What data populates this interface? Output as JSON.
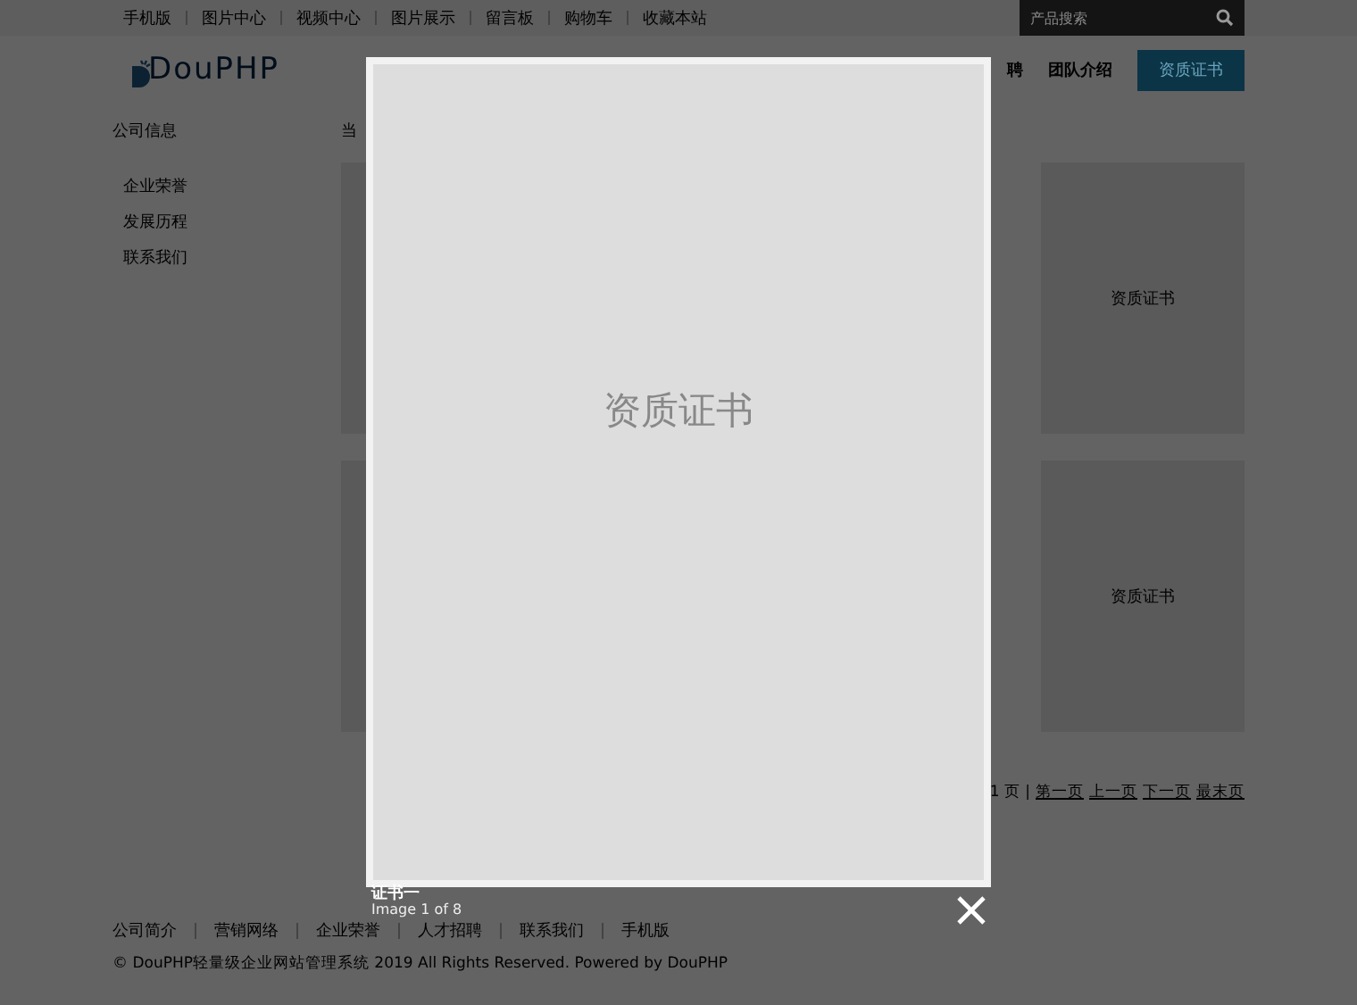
{
  "top_bar": {
    "links": [
      "手机版",
      "图片中心",
      "视频中心",
      "图片展示",
      "留言板",
      "购物车",
      "收藏本站"
    ],
    "search": {
      "placeholder": "产品搜索"
    }
  },
  "header": {
    "logo": "DouPHP",
    "nav": [
      {
        "label": "聘",
        "selected": false
      },
      {
        "label": "团队介绍",
        "selected": false
      },
      {
        "label": "资质证书",
        "selected": true
      }
    ]
  },
  "sidebar": {
    "title": "公司信息",
    "items": [
      "企业荣誉",
      "发展历程",
      "联系我们"
    ]
  },
  "breadcrumb": "当",
  "cards": [
    {
      "kind": "covered"
    },
    {
      "kind": "thumb",
      "label": "资质证书"
    },
    {
      "kind": "covered"
    },
    {
      "kind": "thumb",
      "label": "资质证书"
    }
  ],
  "pagination": {
    "summary": "1 页 |",
    "links": [
      "第一页",
      "上一页",
      "下一页",
      "最末页"
    ]
  },
  "footer": {
    "links": [
      "公司简介",
      "营销网络",
      "企业荣誉",
      "人才招聘",
      "联系我们",
      "手机版"
    ],
    "copyright": "© DouPHP轻量级企业网站管理系统 2019 All Rights Reserved. Powered by DouPHP"
  },
  "lightbox": {
    "image_text": "资质证书",
    "title": "证书一",
    "counter": "Image 1 of 8"
  }
}
